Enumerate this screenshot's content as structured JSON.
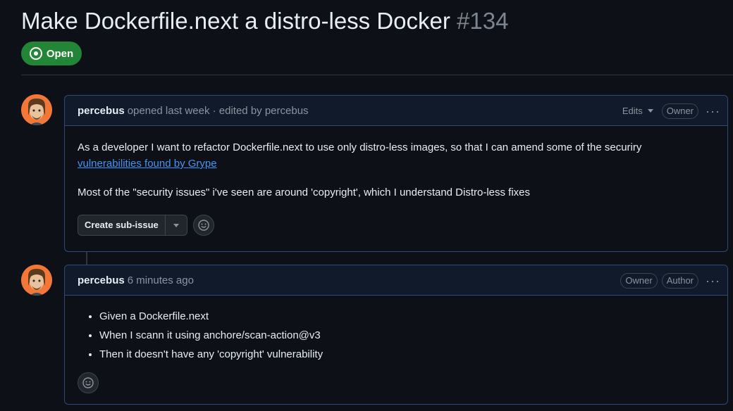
{
  "issue": {
    "title": "Make Dockerfile.next a distro-less Docker",
    "number": "#134",
    "state": "Open"
  },
  "comments": [
    {
      "author": "percebus",
      "meta": "opened last week · edited by percebus",
      "edits_label": "Edits",
      "badges": [
        "Owner"
      ],
      "menu": "···",
      "body": {
        "line1": "As a developer I want to refactor Dockerfile.next to use only distro-less images, so that I can amend some of the securiry",
        "link": "vulnerabilities found by Grype",
        "line2": "Most of the \"security issues\" i've seen are around 'copyright', which I understand Distro-less fixes"
      },
      "create_sub_issue": "Create sub-issue"
    },
    {
      "author": "percebus",
      "meta": "6 minutes ago",
      "badges": [
        "Owner",
        "Author"
      ],
      "menu": "···",
      "body": {
        "items": [
          "Given a Dockerfile.next",
          "When I scann it using anchore/scan-action@v3",
          "Then it doesn't have any 'copyright' vulnerability"
        ]
      }
    }
  ],
  "icons": [
    "issue-open-icon",
    "avatar",
    "caret-down-icon",
    "kebab-icon",
    "smiley-icon"
  ],
  "colors": {
    "bg": "#0d1117",
    "open_green": "#238636",
    "link": "#4493f8",
    "avatar_bg": "#f4773a"
  }
}
